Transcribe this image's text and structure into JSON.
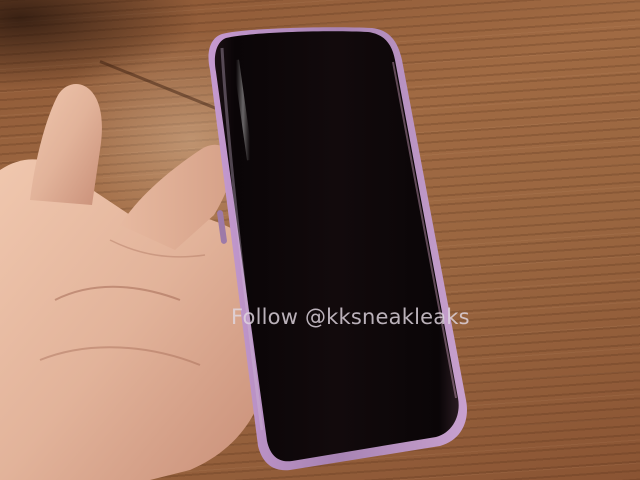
{
  "watermark": {
    "text": "Follow @kksneakleaks"
  },
  "colors": {
    "table_wood": "#9a6640",
    "phone_frame": "#b48cc0",
    "screen": "#0b0607",
    "skin": "#e2b39a"
  },
  "icons": {
    "phone": "smartphone-icon",
    "hand": "hand-icon"
  }
}
